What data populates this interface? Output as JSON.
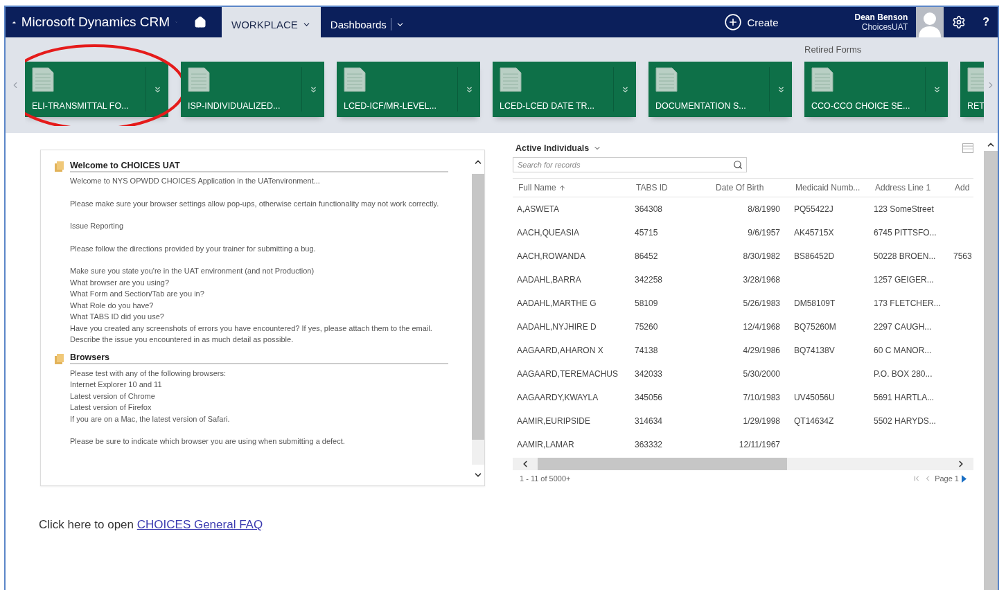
{
  "nav": {
    "brand": "Microsoft Dynamics CRM",
    "tabs": [
      {
        "label": "WORKPLACE",
        "selected": true
      },
      {
        "label": "Dashboards",
        "selected": false
      }
    ],
    "create": "Create",
    "user": {
      "name": "Dean Benson",
      "org": "ChoicesUAT"
    },
    "help": "?"
  },
  "ribbon": {
    "groups": [
      {
        "tiles": [
          {
            "label": "ELI-TRANSMITTAL FO...",
            "circled": true
          },
          {
            "label": "ISP-INDIVIDUALIZED...",
            "circled": false
          },
          {
            "label": "LCED-ICF/MR-LEVEL...",
            "circled": false
          },
          {
            "label": "LCED-LCED DATE TR...",
            "circled": false
          },
          {
            "label": "DOCUMENTATION S...",
            "circled": false
          }
        ]
      },
      {
        "label": "Retired Forms",
        "tiles": [
          {
            "label": "CCO-CCO CHOICE SE...",
            "circled": false
          },
          {
            "label": "RET",
            "circled": false
          }
        ]
      }
    ]
  },
  "welcome_panel": {
    "sections": [
      {
        "title": "Welcome to CHOICES UAT",
        "paragraphs": [
          [
            "Welcome to NYS OPWDD CHOICES Application in the UATenvironment..."
          ],
          [
            "Please make sure your browser settings allow pop-ups, otherwise certain functionality may not work correctly."
          ],
          [
            "Issue Reporting"
          ],
          [
            "Please follow the directions provided by your trainer for submitting a bug."
          ],
          [
            "Make sure you state you're in the UAT environment (and not Production)",
            "What browser are you using?",
            "What Form and Section/Tab are you in?",
            "What Role do you have?",
            "What TABS ID did you use?",
            "Have you created any screenshots of errors you have encountered? If yes, please attach them to the email.",
            "Describe the issue you encountered in as much detail as possible."
          ]
        ]
      },
      {
        "title": "Browsers",
        "paragraphs": [
          [
            "Please test with any of the following browsers:",
            "Internet Explorer 10 and 11",
            "Latest version of Chrome",
            "Latest version of Firefox",
            "If you are on a Mac, the latest version of Safari."
          ],
          [
            "Please be sure to indicate which browser you are using when submitting a defect."
          ]
        ]
      }
    ]
  },
  "faq": {
    "prefix": "Click here to open",
    "link": "CHOICES General FAQ"
  },
  "grid": {
    "title": "Active Individuals",
    "search": {
      "placeholder": "Search for records"
    },
    "columns": [
      {
        "label": "Full Name",
        "sorted": true
      },
      {
        "label": "TABS ID",
        "sorted": false
      },
      {
        "label": "Date Of Birth",
        "sorted": false
      },
      {
        "label": "Medicaid Numb...",
        "sorted": false
      },
      {
        "label": "Address Line 1",
        "sorted": false
      },
      {
        "label": "Add",
        "sorted": false
      }
    ],
    "rows": [
      [
        "A,ASWETA",
        "364308",
        "8/8/1990",
        "PQ55422J",
        "123 SomeStreet",
        ""
      ],
      [
        "AACH,QUEASIA",
        "45715",
        "9/6/1957",
        "AK45715X",
        "6745 PITTSFO...",
        ""
      ],
      [
        "AACH,ROWANDA",
        "86452",
        "8/30/1982",
        "BS86452D",
        "50228 BROEN...",
        "7563"
      ],
      [
        "AADAHL,BARRA",
        "342258",
        "3/28/1968",
        "",
        "1257 GEIGER...",
        ""
      ],
      [
        "AADAHL,MARTHE G",
        "58109",
        "5/26/1983",
        "DM58109T",
        "173 FLETCHER...",
        ""
      ],
      [
        "AADAHL,NYJHIRE D",
        "75260",
        "12/4/1968",
        "BQ75260M",
        "2297 CAUGH...",
        ""
      ],
      [
        "AAGAARD,AHARON X",
        "74138",
        "4/29/1986",
        "BQ74138V",
        "60 C MANOR...",
        ""
      ],
      [
        "AAGAARD,TEREMACHUS",
        "342033",
        "5/30/2000",
        "",
        "P.O. BOX 280...",
        ""
      ],
      [
        "AAGAARDY,KWAYLA",
        "345056",
        "7/10/1983",
        "UV45056U",
        "5691 HARTLA...",
        ""
      ],
      [
        "AAMIR,EURIPSIDE",
        "314634",
        "1/29/1998",
        "QT14634Z",
        "5502 HARYDS...",
        ""
      ],
      [
        "AAMIR,LAMAR",
        "363332",
        "12/11/1967",
        "",
        "",
        ""
      ]
    ],
    "count": "1 - 11 of 5000+",
    "page": "Page 1"
  }
}
